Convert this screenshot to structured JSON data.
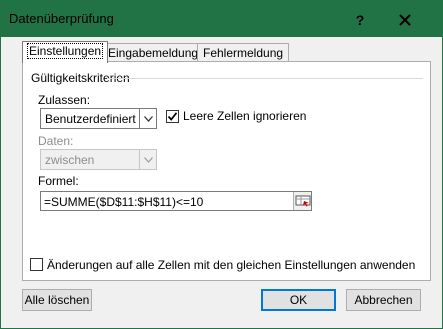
{
  "window": {
    "title": "Datenüberprüfung",
    "help_label": "?",
    "accent_color": "#217346"
  },
  "tabs": [
    {
      "label": "Einstellungen",
      "active": true
    },
    {
      "label": "Eingabemeldung",
      "active": false
    },
    {
      "label": "Fehlermeldung",
      "active": false
    }
  ],
  "settings": {
    "group_label": "Gültigkeitskriterien",
    "allow_label": "Zulassen:",
    "allow_value": "Benutzerdefiniert",
    "ignore_blank_label": "Leere Zellen ignorieren",
    "ignore_blank_checked": true,
    "data_label": "Daten:",
    "data_value": "zwischen",
    "formula_label": "Formel:",
    "formula_value": "=SUMME($D$11:$H$11)<=10",
    "apply_all_label": "Änderungen auf alle Zellen mit den gleichen Einstellungen anwenden",
    "apply_all_checked": false
  },
  "buttons": {
    "clear_all": "Alle löschen",
    "ok": "OK",
    "cancel": "Abbrechen"
  }
}
